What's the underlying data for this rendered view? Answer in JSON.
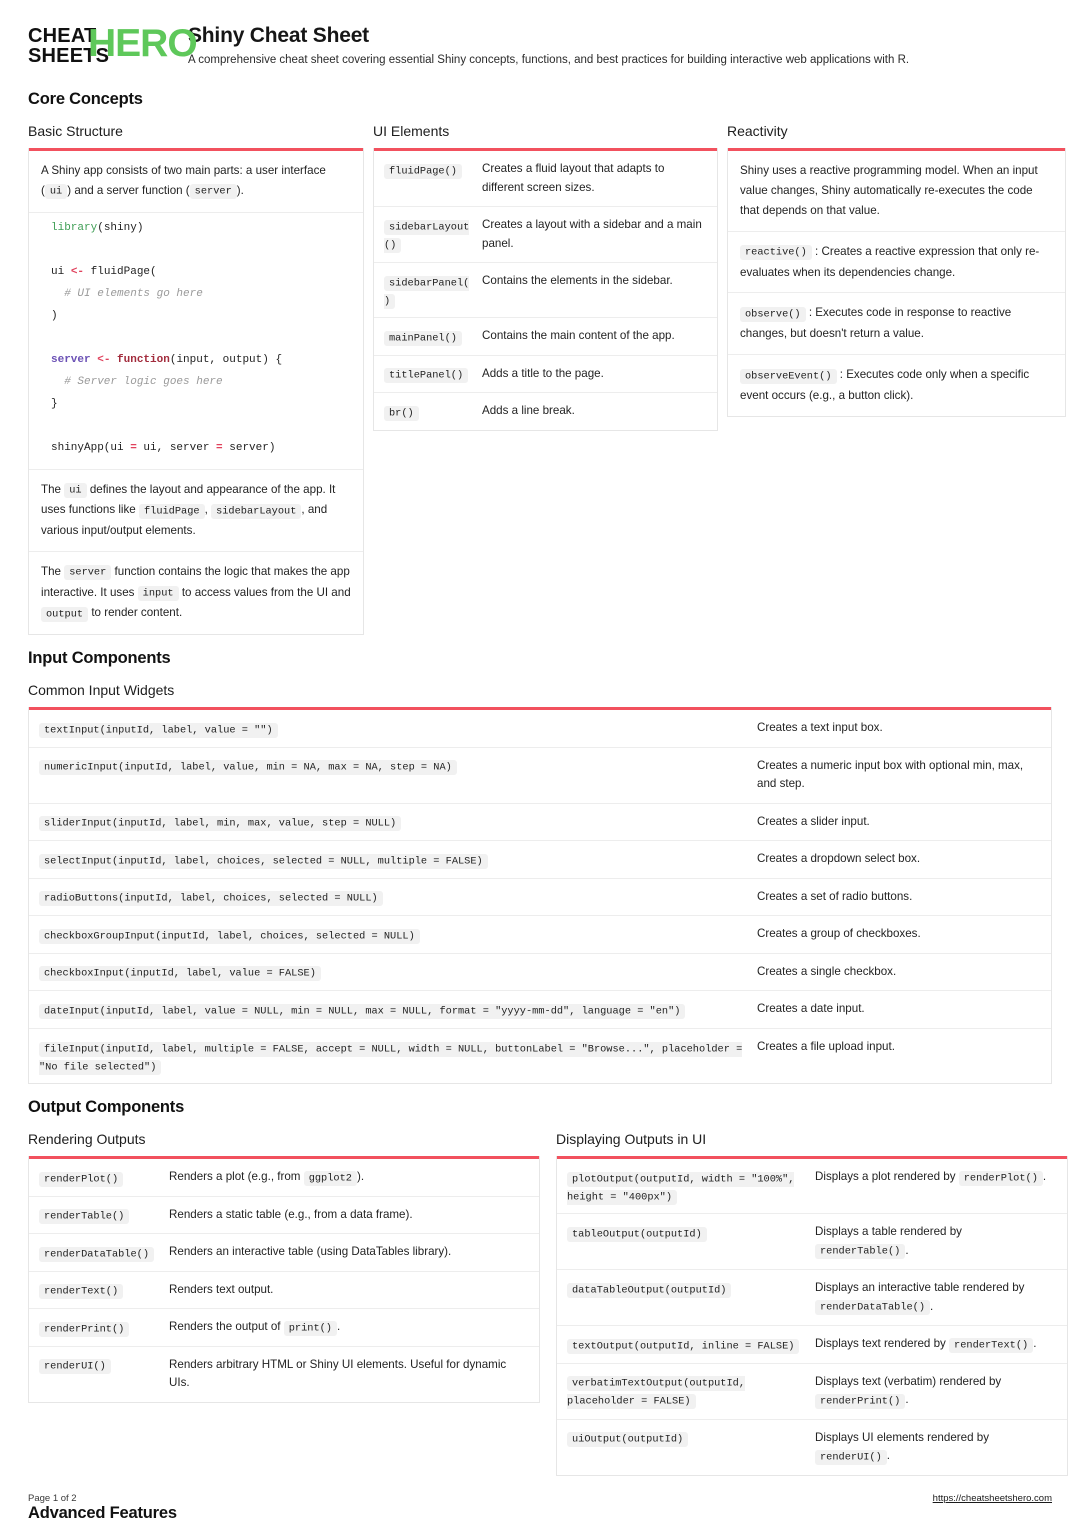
{
  "brand": {
    "logo_line1": "CHEAT",
    "logo_line2": "SHEETS",
    "logo_hero": "HERO",
    "hero_color": "#5ec85a"
  },
  "header": {
    "title": "Shiny Cheat Sheet",
    "subtitle": "A comprehensive cheat sheet covering essential Shiny concepts, functions, and best practices for building interactive web applications with R."
  },
  "accent_color": "#f2515e",
  "sections": {
    "core_concepts": "Core Concepts",
    "input_components": "Input Components",
    "output_components": "Output Components",
    "advanced_features": "Advanced Features"
  },
  "basic_structure": {
    "title": "Basic Structure",
    "intro_a": "A Shiny app consists of two main parts: a user interface (",
    "intro_ui": "ui",
    "intro_b": ") and a server function (",
    "intro_server": "server",
    "intro_c": ").",
    "code": {
      "l1_fn": "library",
      "l1_rest": "(shiny)",
      "l3_a": "ui ",
      "l3_op": "<-",
      "l3_b": " fluidPage(",
      "l4_comment": "# UI elements go here",
      "l5": ")",
      "l7_var": "server",
      "l7_op": "<-",
      "l7_kw": "function",
      "l7_rest": "(input, output) {",
      "l8_comment": "# Server logic goes here",
      "l9": "}",
      "l11_a": "shinyApp(ui ",
      "l11_op1": "=",
      "l11_b": " ui, server ",
      "l11_op2": "=",
      "l11_c": " server)"
    },
    "note1_a": "The",
    "note1_ui": "ui",
    "note1_b": "defines the layout and appearance of the app. It uses functions like",
    "note1_fluid": "fluidPage",
    "note1_comma": ",",
    "note1_sidebar": "sidebarLayout",
    "note1_c": ", and various input/output elements.",
    "note2_a": "The",
    "note2_server": "server",
    "note2_b": "function contains the logic that makes the app interactive. It uses",
    "note2_input": "input",
    "note2_c": "to access values from the UI and",
    "note2_output": "output",
    "note2_d": "to render content."
  },
  "ui_elements": {
    "title": "UI Elements",
    "rows": [
      {
        "code": "fluidPage()",
        "desc": "Creates a fluid layout that adapts to different screen sizes."
      },
      {
        "code": "sidebarLayout()",
        "desc": "Creates a layout with a sidebar and a main panel."
      },
      {
        "code": "sidebarPanel()",
        "desc": "Contains the elements in the sidebar."
      },
      {
        "code": "mainPanel()",
        "desc": "Contains the main content of the app."
      },
      {
        "code": "titlePanel()",
        "desc": "Adds a title to the page."
      },
      {
        "code": "br()",
        "desc": "Adds a line break."
      }
    ]
  },
  "reactivity": {
    "title": "Reactivity",
    "intro": "Shiny uses a reactive programming model. When an input value changes, Shiny automatically re-executes the code that depends on that value.",
    "items": [
      {
        "code": "reactive()",
        "desc": ": Creates a reactive expression that only re-evaluates when its dependencies change."
      },
      {
        "code": "observe()",
        "desc": ": Executes code in response to reactive changes, but doesn't return a value."
      },
      {
        "code": "observeEvent()",
        "desc": ": Executes code only when a specific event occurs (e.g., a button click)."
      }
    ]
  },
  "common_input_widgets": {
    "title": "Common Input Widgets",
    "rows": [
      {
        "code": "textInput(inputId, label, value = \"\")",
        "desc": "Creates a text input box."
      },
      {
        "code": "numericInput(inputId, label, value, min = NA, max = NA, step = NA)",
        "desc": "Creates a numeric input box with optional min, max, and step."
      },
      {
        "code": "sliderInput(inputId, label, min, max, value, step = NULL)",
        "desc": "Creates a slider input."
      },
      {
        "code": "selectInput(inputId, label, choices, selected = NULL, multiple = FALSE)",
        "desc": "Creates a dropdown select box."
      },
      {
        "code": "radioButtons(inputId, label, choices, selected = NULL)",
        "desc": "Creates a set of radio buttons."
      },
      {
        "code": "checkboxGroupInput(inputId, label, choices, selected = NULL)",
        "desc": "Creates a group of checkboxes."
      },
      {
        "code": "checkboxInput(inputId, label, value = FALSE)",
        "desc": "Creates a single checkbox."
      },
      {
        "code": "dateInput(inputId, label, value = NULL, min = NULL, max = NULL, format = \"yyyy-mm-dd\", language = \"en\")",
        "desc": "Creates a date input."
      },
      {
        "code": "fileInput(inputId, label, multiple = FALSE, accept = NULL, width = NULL, buttonLabel = \"Browse...\", placeholder = \"No file selected\")",
        "desc": "Creates a file upload input."
      }
    ]
  },
  "rendering_outputs": {
    "title": "Rendering Outputs",
    "rows": [
      {
        "code": "renderPlot()",
        "pre": "Renders a plot (e.g., from",
        "mid": "ggplot2",
        "post": ")."
      },
      {
        "code": "renderTable()",
        "pre": "Renders a static table (e.g., from a data frame).",
        "mid": "",
        "post": ""
      },
      {
        "code": "renderDataTable()",
        "pre": "Renders an interactive table (using DataTables library).",
        "mid": "",
        "post": ""
      },
      {
        "code": "renderText()",
        "pre": "Renders text output.",
        "mid": "",
        "post": ""
      },
      {
        "code": "renderPrint()",
        "pre": "Renders the output of",
        "mid": "print()",
        "post": "."
      },
      {
        "code": "renderUI()",
        "pre": "Renders arbitrary HTML or Shiny UI elements. Useful for dynamic UIs.",
        "mid": "",
        "post": ""
      }
    ]
  },
  "displaying_outputs": {
    "title": "Displaying Outputs in UI",
    "rows": [
      {
        "code": "plotOutput(outputId, width = \"100%\", height = \"400px\")",
        "pre": "Displays a plot rendered by",
        "mid": "renderPlot()",
        "post": "."
      },
      {
        "code": "tableOutput(outputId)",
        "pre": "Displays a table rendered by",
        "mid": "renderTable()",
        "post": "."
      },
      {
        "code": "dataTableOutput(outputId)",
        "pre": "Displays an interactive table rendered by",
        "mid": "renderDataTable()",
        "post": "."
      },
      {
        "code": "textOutput(outputId, inline = FALSE)",
        "pre": "Displays text rendered by",
        "mid": "renderText()",
        "post": "."
      },
      {
        "code": "verbatimTextOutput(outputId, placeholder = FALSE)",
        "pre": "Displays text (verbatim) rendered by",
        "mid": "renderPrint()",
        "post": "."
      },
      {
        "code": "uiOutput(outputId)",
        "pre": "Displays UI elements rendered by",
        "mid": "renderUI()",
        "post": "."
      }
    ]
  },
  "footer": {
    "page": "Page 1 of 2",
    "url": "https://cheatsheetshero.com"
  }
}
